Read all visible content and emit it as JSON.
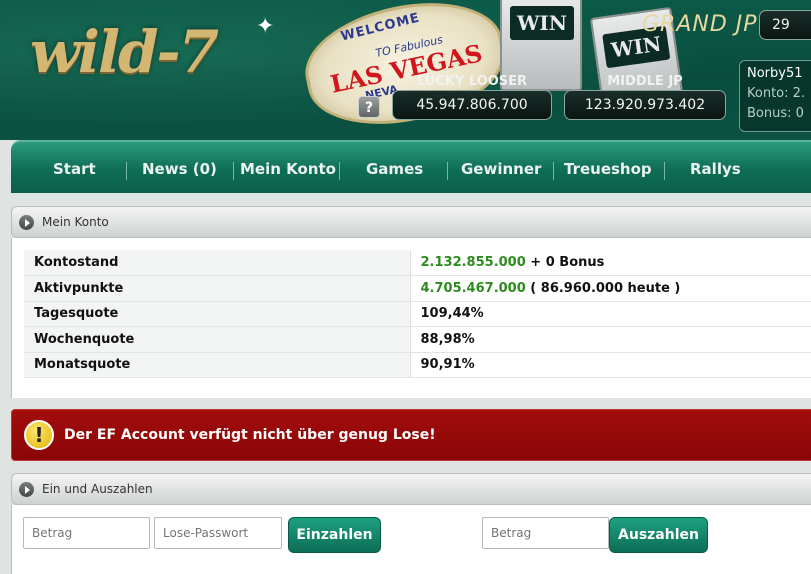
{
  "brand": {
    "logo_text": "wild-7"
  },
  "banner": {
    "vegas_welcome": "WELCOME",
    "vegas_fabulous": "TO Fabulous",
    "vegas_title": "LAS VEGAS",
    "vegas_nevada": "NEVA",
    "slot_label": "WIN",
    "help_label": "?"
  },
  "jackpots": {
    "grand_label": "GRAND JP",
    "grand_value": "29",
    "lucky_label": "LUCKY LOOSER",
    "lucky_value": "45.947.806.700",
    "middle_label": "MIDDLE JP",
    "middle_value": "123.920.973.402"
  },
  "user": {
    "name": "Norby51",
    "konto_line": "Konto: 2.",
    "bonus_line": "Bonus: 0"
  },
  "nav": [
    {
      "label": "Start"
    },
    {
      "label": "News (0)"
    },
    {
      "label": "Mein Konto"
    },
    {
      "label": "Games"
    },
    {
      "label": "Gewinner"
    },
    {
      "label": "Treueshop"
    },
    {
      "label": "Rallys"
    }
  ],
  "konto_panel": {
    "title": "Mein Konto",
    "rows": [
      {
        "label": "Kontostand",
        "value_green": "2.132.855.000",
        "value_rest": " + 0 Bonus"
      },
      {
        "label": "Aktivpunkte",
        "value_green": "4.705.467.000",
        "value_rest": " ( 86.960.000 heute )"
      },
      {
        "label": "Tagesquote",
        "value_green": "",
        "value_rest": "109,44%"
      },
      {
        "label": "Wochenquote",
        "value_green": "",
        "value_rest": "88,98%"
      },
      {
        "label": "Monatsquote",
        "value_green": "",
        "value_rest": "90,91%"
      }
    ]
  },
  "alert": {
    "icon_label": "!",
    "message": "Der EF Account verfügt nicht über genug Lose!"
  },
  "transfer_panel": {
    "title": "Ein und Auszahlen",
    "deposit_amount_placeholder": "Betrag",
    "deposit_password_placeholder": "Lose-Passwort",
    "deposit_button": "Einzahlen",
    "withdraw_amount_placeholder": "Betrag",
    "withdraw_button": "Auszahlen"
  },
  "colors": {
    "brand_green": "#0c6e57",
    "value_green": "#2e8b1f",
    "alert_red": "#8a0606"
  }
}
